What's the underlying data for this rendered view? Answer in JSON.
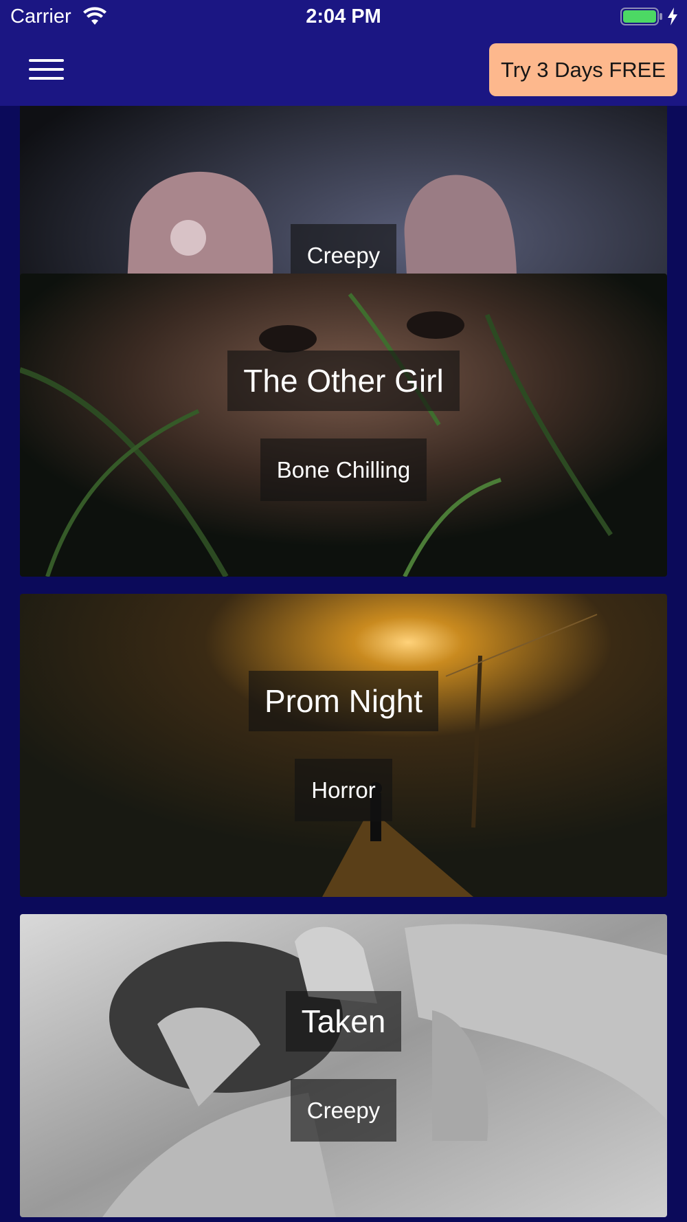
{
  "status_bar": {
    "carrier": "Carrier",
    "time": "2:04 PM"
  },
  "navbar": {
    "trial_label": "Try 3 Days FREE"
  },
  "cards": [
    {
      "title": "",
      "genre": "Creepy"
    },
    {
      "title": "The Other Girl",
      "genre": "Bone Chilling"
    },
    {
      "title": "Prom Night",
      "genre": "Horror"
    },
    {
      "title": "Taken",
      "genre": "Creepy"
    }
  ],
  "colors": {
    "header_bg": "#1b1683",
    "page_bg": "#0b0a5a",
    "trial_button": "#fdb88d",
    "battery_fill": "#4cd964"
  },
  "icons": [
    "wifi-icon",
    "battery-icon",
    "charging-bolt-icon",
    "hamburger-menu-icon"
  ]
}
